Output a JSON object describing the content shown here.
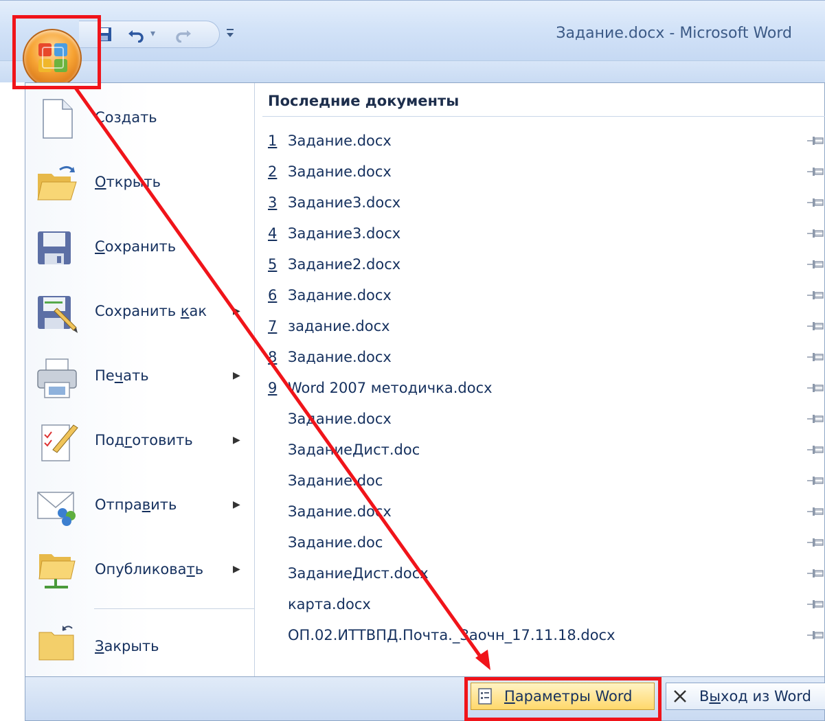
{
  "window": {
    "title": "Задание.docx - Microsoft Word"
  },
  "qat": {
    "icons": [
      "save-icon",
      "undo-icon",
      "undo-dropdown-icon",
      "redo-icon",
      "customize-icon"
    ]
  },
  "menu": {
    "items": [
      {
        "pre": "",
        "u": "",
        "post": "Создать",
        "icon": "new-document-icon",
        "has_submenu": false
      },
      {
        "pre": "",
        "u": "О",
        "post": "ткрыть",
        "icon": "open-folder-icon",
        "has_submenu": false
      },
      {
        "pre": "",
        "u": "С",
        "post": "охранить",
        "icon": "save-icon",
        "has_submenu": false
      },
      {
        "pre": "Сохранить ",
        "u": "к",
        "post": "ак",
        "icon": "save-as-icon",
        "has_submenu": true
      },
      {
        "pre": "Пе",
        "u": "ч",
        "post": "ать",
        "icon": "printer-icon",
        "has_submenu": true
      },
      {
        "pre": "Под",
        "u": "г",
        "post": "отовить",
        "icon": "prepare-icon",
        "has_submenu": true
      },
      {
        "pre": "Отпра",
        "u": "в",
        "post": "ить",
        "icon": "send-icon",
        "has_submenu": true
      },
      {
        "pre": "Опубликова",
        "u": "т",
        "post": "ь",
        "icon": "publish-icon",
        "has_submenu": true
      },
      {
        "pre": "",
        "u": "З",
        "post": "акрыть",
        "icon": "close-folder-icon",
        "has_submenu": false
      }
    ]
  },
  "recent": {
    "header": "Последние документы",
    "documents": [
      {
        "num": "1",
        "name": "Задание.docx"
      },
      {
        "num": "2",
        "name": "Задание.docx"
      },
      {
        "num": "3",
        "name": "Задание3.docx"
      },
      {
        "num": "4",
        "name": "Задание3.docx"
      },
      {
        "num": "5",
        "name": "Задание2.docx"
      },
      {
        "num": "6",
        "name": "Задание.docx"
      },
      {
        "num": "7",
        "name": "задание.docx"
      },
      {
        "num": "8",
        "name": "Задание.docx"
      },
      {
        "num": "9",
        "name": "Word 2007 методичка.docx"
      },
      {
        "num": "",
        "name": "Задание.docx"
      },
      {
        "num": "",
        "name": "ЗаданиеДист.doc"
      },
      {
        "num": "",
        "name": "Задание.doc"
      },
      {
        "num": "",
        "name": "Задание.docx"
      },
      {
        "num": "",
        "name": "Задание.doc"
      },
      {
        "num": "",
        "name": "ЗаданиеДист.docx"
      },
      {
        "num": "",
        "name": "карта.docx"
      },
      {
        "num": "",
        "name": "ОП.02.ИТТВПД.Почта._Заочн_17.11.18.docx"
      }
    ]
  },
  "footer": {
    "options": {
      "u": "П",
      "rest": "араметры Word",
      "icon": "options-icon"
    },
    "exit": {
      "pre": "В",
      "u": "ы",
      "post": "ход из Word",
      "icon": "close-x-icon"
    }
  },
  "annotation": {
    "color": "#f0141a"
  }
}
